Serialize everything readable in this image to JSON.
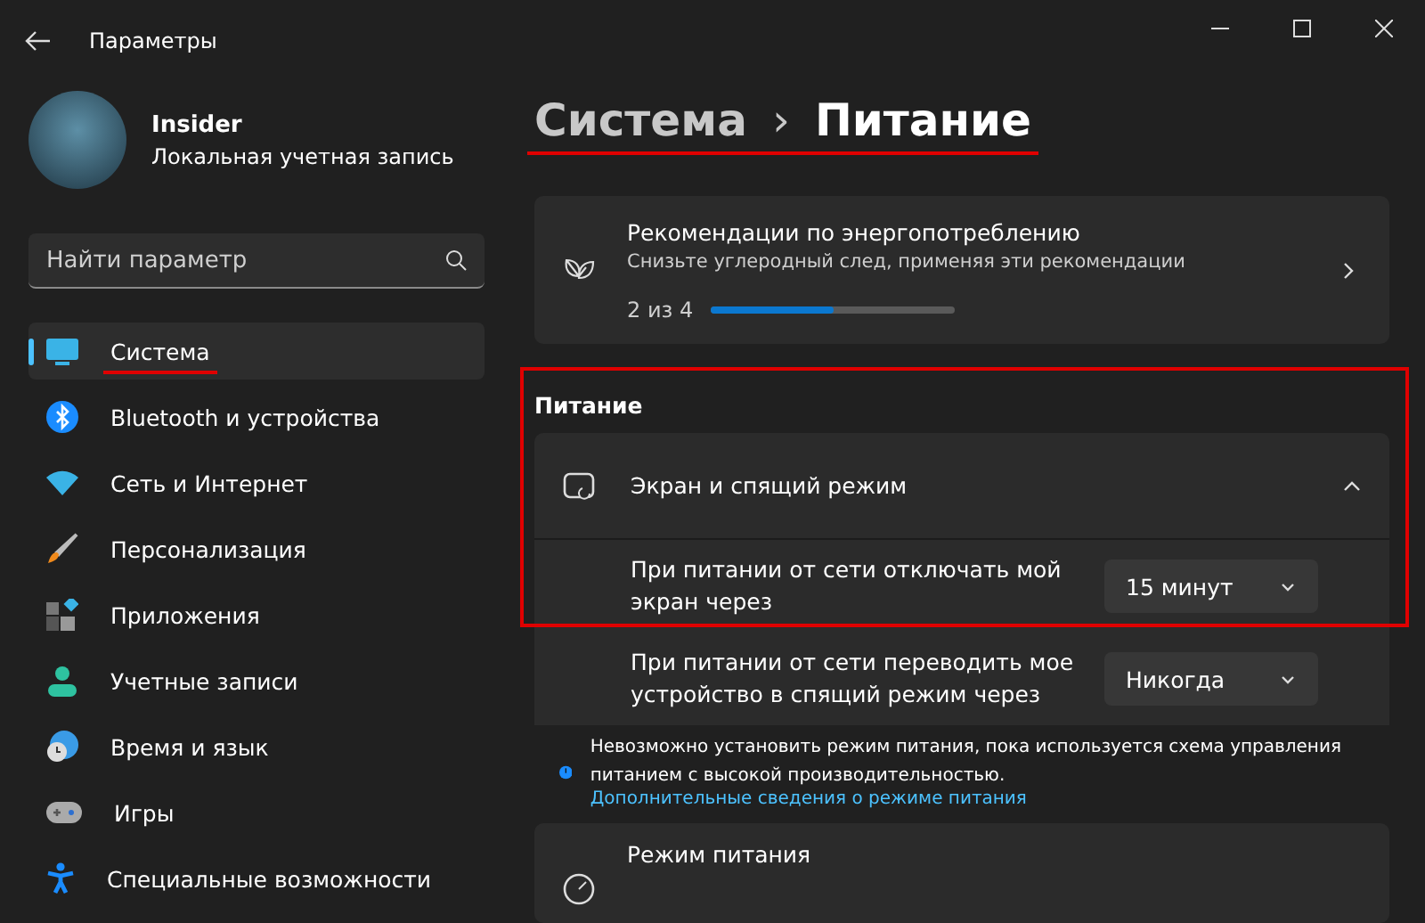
{
  "window": {
    "title": "Параметры"
  },
  "user": {
    "name": "Insider",
    "account": "Локальная учетная запись"
  },
  "search": {
    "placeholder": "Найти параметр"
  },
  "sidebar": {
    "items": [
      {
        "label": "Система",
        "selected": true,
        "underlined": true
      },
      {
        "label": "Bluetooth и устройства",
        "selected": false,
        "underlined": false
      },
      {
        "label": "Сеть и Интернет",
        "selected": false,
        "underlined": false
      },
      {
        "label": "Персонализация",
        "selected": false,
        "underlined": false
      },
      {
        "label": "Приложения",
        "selected": false,
        "underlined": false
      },
      {
        "label": "Учетные записи",
        "selected": false,
        "underlined": false
      },
      {
        "label": "Время и язык",
        "selected": false,
        "underlined": false
      },
      {
        "label": "Игры",
        "selected": false,
        "underlined": false
      },
      {
        "label": "Специальные возможности",
        "selected": false,
        "underlined": false
      }
    ]
  },
  "breadcrumb": {
    "parent": "Система",
    "separator": "›",
    "current": "Питание",
    "underlined": true
  },
  "recommendations": {
    "title": "Рекомендации по энергопотреблению",
    "subtitle": "Снизьте углеродный след, применяя эти рекомендации",
    "progress_text": "2 из 4",
    "level": 0.5
  },
  "power_section": {
    "heading": "Питание",
    "highlighted": true,
    "expander": {
      "title": "Экран и спящий режим",
      "expanded": true,
      "rows": [
        {
          "label": "При питании от сети отключать мой экран через",
          "value": "15 минут"
        },
        {
          "label": "При питании от сети переводить мое устройство в спящий режим через",
          "value": "Никогда"
        }
      ]
    }
  },
  "info": {
    "text": "Невозможно установить режим питания, пока используется схема управления питанием с высокой производительностью.",
    "link": "Дополнительные сведения о режиме питания"
  },
  "power_mode": {
    "title": "Режим питания"
  }
}
